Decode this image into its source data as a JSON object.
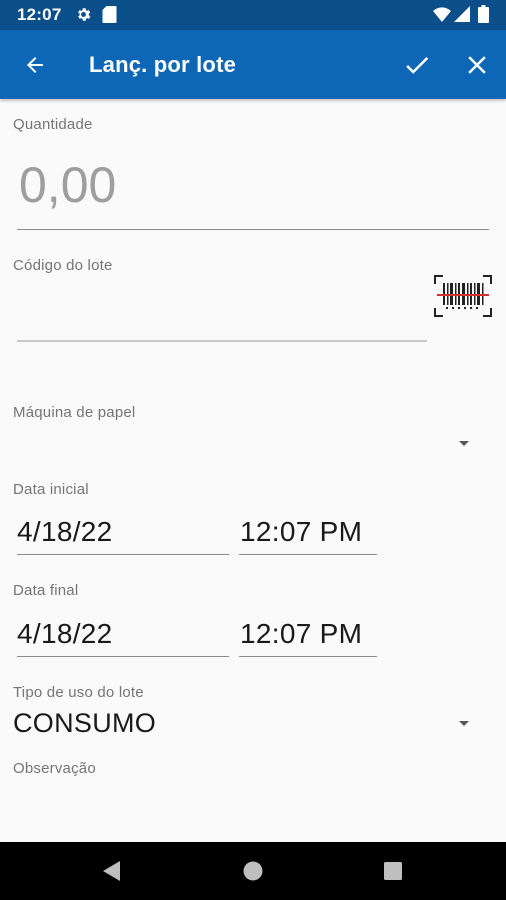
{
  "status_bar": {
    "time": "12:07",
    "icons": [
      "gear-icon",
      "sd-card-icon",
      "wifi-icon",
      "signal-icon",
      "battery-icon"
    ]
  },
  "app_bar": {
    "title": "Lanç. por lote",
    "back_icon": "arrow-left-icon",
    "confirm_icon": "check-icon",
    "close_icon": "close-icon",
    "background": "#0e67b6"
  },
  "form": {
    "quantidade": {
      "label": "Quantidade",
      "value": "",
      "placeholder": "0,00"
    },
    "codigo_lote": {
      "label": "Código do lote",
      "value": "",
      "scan_icon": "barcode-scan-icon"
    },
    "maquina_papel": {
      "label": "Máquina de papel",
      "selected": ""
    },
    "data_inicial": {
      "label": "Data inicial",
      "date": "4/18/22",
      "time": "12:07 PM"
    },
    "data_final": {
      "label": "Data final",
      "date": "4/18/22",
      "time": "12:07 PM"
    },
    "tipo_uso": {
      "label": "Tipo de uso do lote",
      "selected": "CONSUMO"
    },
    "observacao": {
      "label": "Observação",
      "value": ""
    }
  },
  "nav_bar": {
    "icons": [
      "back-triangle-icon",
      "home-circle-icon",
      "recents-square-icon"
    ]
  }
}
